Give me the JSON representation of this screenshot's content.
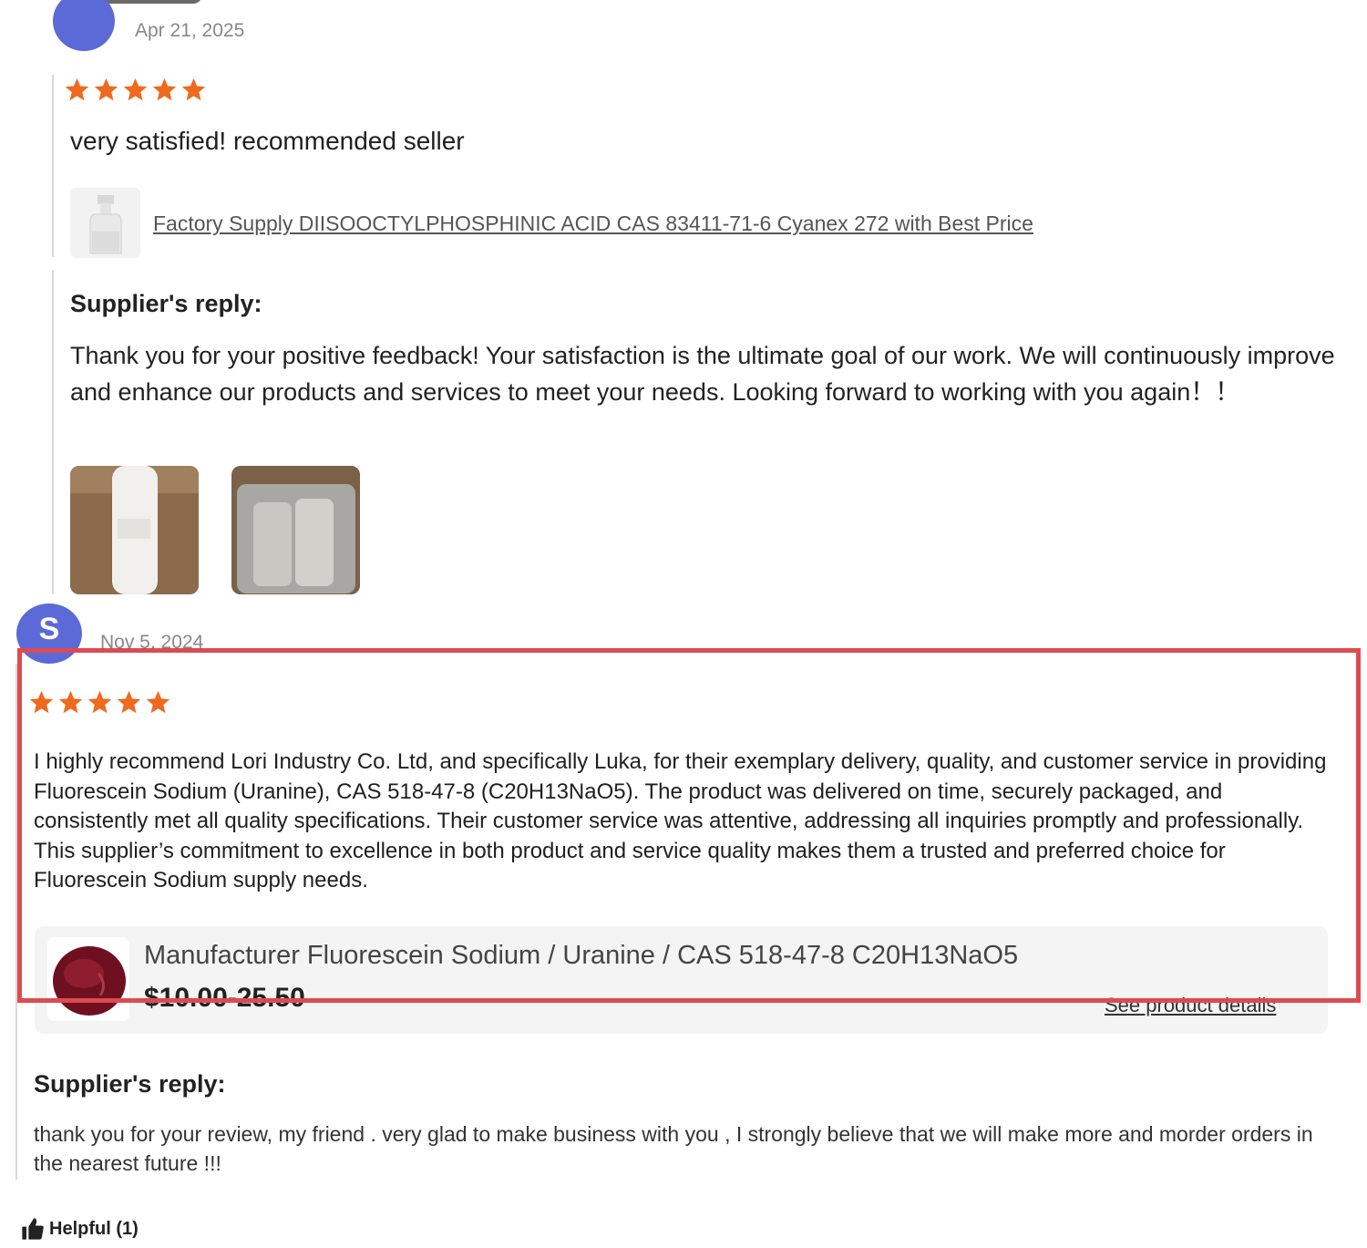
{
  "review_1": {
    "date": "Apr 21, 2025",
    "rating": 5,
    "text": "very satisfied! recommended seller",
    "product_link": "Factory Supply DIISOOCTYLPHOSPHINIC ACID CAS 83411-71-6 Cyanex 272 with Best Price",
    "reply_title": "Supplier's reply:",
    "reply_text": "Thank you for your positive feedback! Your satisfaction is the ultimate goal of our work. We will continuously improve and enhance our products and services to meet your needs. Looking forward to working with you again！！"
  },
  "review_2": {
    "avatar_letter": "S",
    "date": "Nov 5, 2024",
    "rating": 5,
    "text": "I highly recommend Lori Industry Co. Ltd, and specifically Luka, for their exemplary delivery, quality, and customer service in providing Fluorescein Sodium (Uranine), CAS 518-47-8 (C20H13NaO5). The product was delivered on time, securely packaged, and consistently met all quality specifications. Their customer service was attentive, addressing all inquiries promptly and professionally. This supplier’s commitment to excellence in both product and service quality makes them a trusted and preferred choice for Fluorescein Sodium supply needs.",
    "product_name": "Manufacturer Fluorescein Sodium / Uranine / CAS 518-47-8 C20H13NaO5",
    "product_price": "$10.00-25.50",
    "see_details": "See product details",
    "reply_title": "Supplier's reply:",
    "reply_text": "thank you for your review, my friend . very glad to make business with you , I strongly believe that we will make more and morder orders in the nearest future !!!"
  },
  "helpful": {
    "label": "Helpful (1)",
    "icon": "thumbs-up-icon"
  },
  "colors": {
    "star": "#ef6a1e",
    "avatar": "#5b6ad6",
    "highlight": "#dd4a52"
  }
}
